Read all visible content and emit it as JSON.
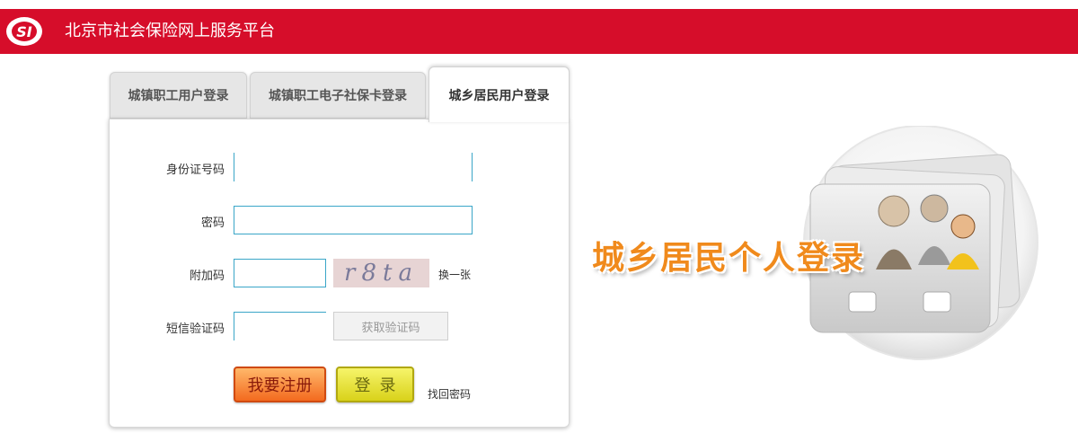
{
  "header": {
    "logo_text": "SI",
    "title": "北京市社会保险网上服务平台",
    "color": "#d60d2a"
  },
  "tabs": [
    {
      "label": "城镇职工用户登录",
      "active": false
    },
    {
      "label": "城镇职工电子社保卡登录",
      "active": false
    },
    {
      "label": "城乡居民用户登录",
      "active": true
    }
  ],
  "form": {
    "id_label": "身份证号码",
    "id_value": "",
    "password_label": "密码",
    "password_value": "",
    "captcha_label": "附加码",
    "captcha_value": "",
    "captcha_image_text": "r8ta",
    "captcha_refresh": "换一张",
    "sms_label": "短信验证码",
    "sms_value": "",
    "sms_button": "获取验证码",
    "register_button": "我要注册",
    "login_button": "登录",
    "forgot_link": "找回密码"
  },
  "illustration": {
    "text": "城乡居民个人登录",
    "text_color": "#f08a1c"
  }
}
